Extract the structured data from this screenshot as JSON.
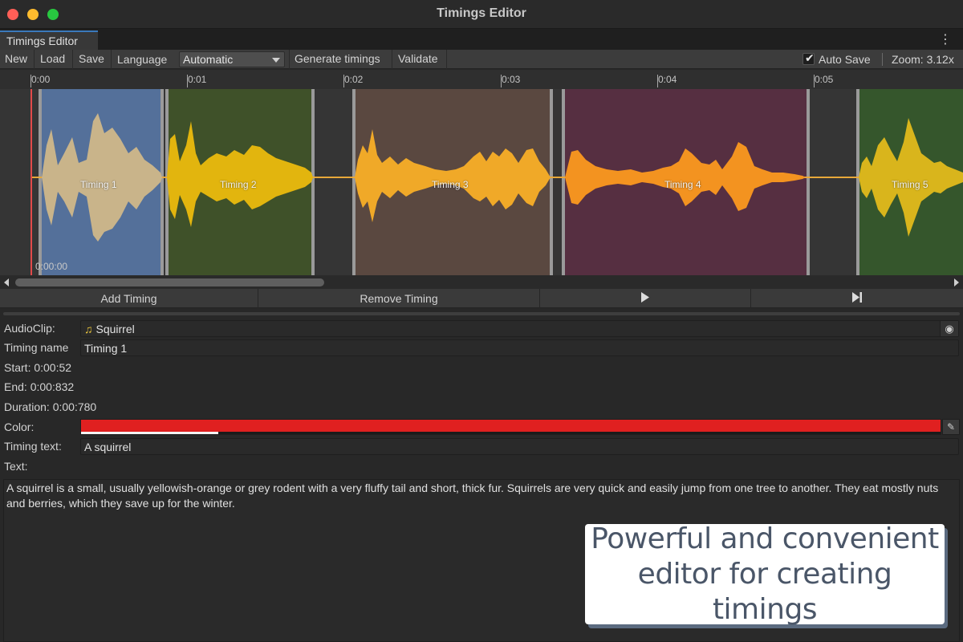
{
  "window": {
    "title": "Timings Editor"
  },
  "tab": {
    "label": "Timings Editor",
    "menu_icon": "kebab-menu-icon"
  },
  "toolbar": {
    "new_label": "New",
    "load_label": "Load",
    "save_label": "Save",
    "language_label": "Language",
    "language_value": "Automatic",
    "generate_label": "Generate timings",
    "validate_label": "Validate",
    "autosave_label": "Auto Save",
    "autosave_checked": true,
    "zoom_label": "Zoom: 3.12x"
  },
  "timeline": {
    "ticks": [
      "0:00",
      "0:01",
      "0:02",
      "0:03",
      "0:04",
      "0:05"
    ],
    "current_time": "0:00:00",
    "segments": [
      {
        "label": "Timing 1",
        "color": "#54709a",
        "wave_color": "#c9b48a"
      },
      {
        "label": "Timing 2",
        "color": "#3f5129",
        "wave_color": "#e2b50e"
      },
      {
        "label": "Timing 3",
        "color": "#5a4840",
        "wave_color": "#f0a928"
      },
      {
        "label": "Timing 4",
        "color": "#562f41",
        "wave_color": "#f39320"
      },
      {
        "label": "Timing 5",
        "color": "#35562c",
        "wave_color": "#d9b51c"
      }
    ],
    "gap_wave_color": "#e8a83a"
  },
  "actions": {
    "add_label": "Add Timing",
    "remove_label": "Remove Timing",
    "play_icon": "play-icon",
    "skip_icon": "skip-next-icon"
  },
  "inspector": {
    "audioclip_label": "AudioClip:",
    "audioclip_value": "Squirrel",
    "timing_name_label": "Timing name",
    "timing_name_value": "Timing 1",
    "start_text": "Start: 0:00:52",
    "end_text": "End: 0:00:832",
    "duration_text": "Duration: 0:00:780",
    "color_label": "Color:",
    "color_value": "#e02020",
    "timing_text_label": "Timing text:",
    "timing_text_value": "A squirrel",
    "text_label": "Text:",
    "text_value": "A squirrel is a small, usually yellowish-orange or grey rodent with a very fluffy tail and short, thick fur. Squirrels are very quick and easily jump from one tree to another. They eat mostly nuts and berries, which they save up for the winter."
  },
  "promo": {
    "line1": "Powerful and convenient",
    "line2": "editor for creating timings"
  }
}
